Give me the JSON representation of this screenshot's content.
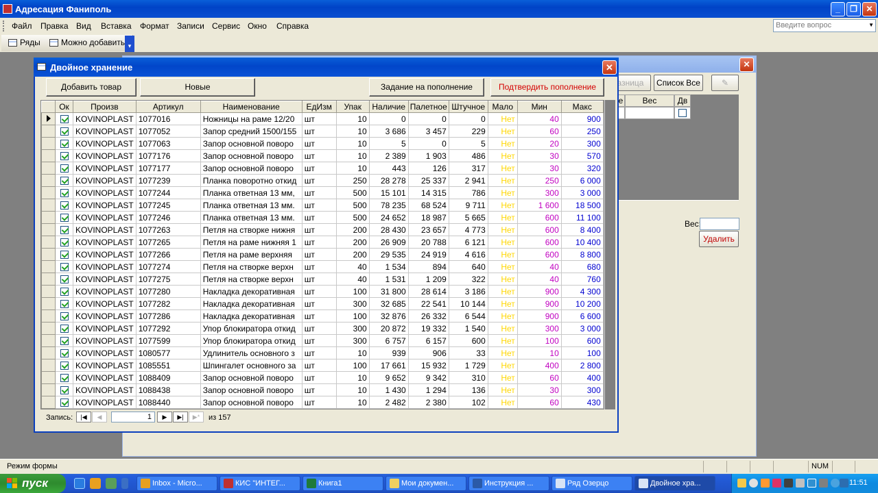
{
  "app": {
    "title": "Адресация Фаниполь",
    "menu": [
      "Файл",
      "Правка",
      "Вид",
      "Вставка",
      "Формат",
      "Записи",
      "Сервис",
      "Окно",
      "Справка"
    ],
    "ask_placeholder": "Введите вопрос",
    "toolbar": {
      "rows_label": "Ряды",
      "can_add_label": "Можно добавить"
    }
  },
  "bg_form": {
    "buttons": {
      "raznica": "азница",
      "list_all": "Список Все",
      "delete": "Удалить"
    },
    "grid_headers": [
      "е",
      "Вес",
      "Дв"
    ],
    "weight_label": "Вес:"
  },
  "form": {
    "title": "Двойное хранение",
    "buttons": {
      "add_product": "Добавить товар",
      "new": "Новые",
      "replenish_task": "Задание на пополнение",
      "confirm_replenish": "Подтвердить пополнение"
    },
    "columns": [
      "Ок",
      "Произв",
      "Артикул",
      "Наименование",
      "ЕдИзм",
      "Упак",
      "Наличие",
      "Палетное",
      "Штучное",
      "Мало",
      "Мин",
      "Макс"
    ],
    "rows": [
      {
        "ok": true,
        "proizv": "KOVINOPLAST",
        "art": "1077016",
        "name": "Ножницы на раме 12/20",
        "ed": "шт",
        "upak": "10",
        "nal": "0",
        "pal": "0",
        "sht": "0",
        "malo": "Нет",
        "min": "40",
        "max": "900"
      },
      {
        "ok": true,
        "proizv": "KOVINOPLAST",
        "art": "1077052",
        "name": "Запор средний 1500/155",
        "ed": "шт",
        "upak": "10",
        "nal": "3 686",
        "pal": "3 457",
        "sht": "229",
        "malo": "Нет",
        "min": "60",
        "max": "250"
      },
      {
        "ok": true,
        "proizv": "KOVINOPLAST",
        "art": "1077063",
        "name": "Запор основной поворо",
        "ed": "шт",
        "upak": "10",
        "nal": "5",
        "pal": "0",
        "sht": "5",
        "malo": "Нет",
        "min": "20",
        "max": "300"
      },
      {
        "ok": true,
        "proizv": "KOVINOPLAST",
        "art": "1077176",
        "name": "Запор основной поворо",
        "ed": "шт",
        "upak": "10",
        "nal": "2 389",
        "pal": "1 903",
        "sht": "486",
        "malo": "Нет",
        "min": "30",
        "max": "570"
      },
      {
        "ok": true,
        "proizv": "KOVINOPLAST",
        "art": "1077177",
        "name": "Запор основной поворо",
        "ed": "шт",
        "upak": "10",
        "nal": "443",
        "pal": "126",
        "sht": "317",
        "malo": "Нет",
        "min": "30",
        "max": "320"
      },
      {
        "ok": true,
        "proizv": "KOVINOPLAST",
        "art": "1077239",
        "name": "Планка поворотно откид",
        "ed": "шт",
        "upak": "250",
        "nal": "28 278",
        "pal": "25 337",
        "sht": "2 941",
        "malo": "Нет",
        "min": "250",
        "max": "6 000"
      },
      {
        "ok": true,
        "proizv": "KOVINOPLAST",
        "art": "1077244",
        "name": "Планка ответная 13 мм,",
        "ed": "шт",
        "upak": "500",
        "nal": "15 101",
        "pal": "14 315",
        "sht": "786",
        "malo": "Нет",
        "min": "300",
        "max": "3 000"
      },
      {
        "ok": true,
        "proizv": "KOVINOPLAST",
        "art": "1077245",
        "name": "Планка ответная 13 мм.",
        "ed": "шт",
        "upak": "500",
        "nal": "78 235",
        "pal": "68 524",
        "sht": "9 711",
        "malo": "Нет",
        "min": "1 600",
        "max": "18 500"
      },
      {
        "ok": true,
        "proizv": "KOVINOPLAST",
        "art": "1077246",
        "name": "Планка ответная 13 мм.",
        "ed": "шт",
        "upak": "500",
        "nal": "24 652",
        "pal": "18 987",
        "sht": "5 665",
        "malo": "Нет",
        "min": "600",
        "max": "11 100"
      },
      {
        "ok": true,
        "proizv": "KOVINOPLAST",
        "art": "1077263",
        "name": "Петля на створке нижня",
        "ed": "шт",
        "upak": "200",
        "nal": "28 430",
        "pal": "23 657",
        "sht": "4 773",
        "malo": "Нет",
        "min": "600",
        "max": "8 400"
      },
      {
        "ok": true,
        "proizv": "KOVINOPLAST",
        "art": "1077265",
        "name": "Петля на раме нижняя 1",
        "ed": "шт",
        "upak": "200",
        "nal": "26 909",
        "pal": "20 788",
        "sht": "6 121",
        "malo": "Нет",
        "min": "600",
        "max": "10 400"
      },
      {
        "ok": true,
        "proizv": "KOVINOPLAST",
        "art": "1077266",
        "name": "Петля на раме верхняя",
        "ed": "шт",
        "upak": "200",
        "nal": "29 535",
        "pal": "24 919",
        "sht": "4 616",
        "malo": "Нет",
        "min": "600",
        "max": "8 800"
      },
      {
        "ok": true,
        "proizv": "KOVINOPLAST",
        "art": "1077274",
        "name": "Петля на створке верхн",
        "ed": "шт",
        "upak": "40",
        "nal": "1 534",
        "pal": "894",
        "sht": "640",
        "malo": "Нет",
        "min": "40",
        "max": "680"
      },
      {
        "ok": true,
        "proizv": "KOVINOPLAST",
        "art": "1077275",
        "name": "Петля на створке верхн",
        "ed": "шт",
        "upak": "40",
        "nal": "1 531",
        "pal": "1 209",
        "sht": "322",
        "malo": "Нет",
        "min": "40",
        "max": "760"
      },
      {
        "ok": true,
        "proizv": "KOVINOPLAST",
        "art": "1077280",
        "name": "Накладка декоративная",
        "ed": "шт",
        "upak": "100",
        "nal": "31 800",
        "pal": "28 614",
        "sht": "3 186",
        "malo": "Нет",
        "min": "900",
        "max": "4 300"
      },
      {
        "ok": true,
        "proizv": "KOVINOPLAST",
        "art": "1077282",
        "name": "Накладка декоративная",
        "ed": "шт",
        "upak": "300",
        "nal": "32 685",
        "pal": "22 541",
        "sht": "10 144",
        "malo": "Нет",
        "min": "900",
        "max": "10 200"
      },
      {
        "ok": true,
        "proizv": "KOVINOPLAST",
        "art": "1077286",
        "name": "Накладка декоративная",
        "ed": "шт",
        "upak": "100",
        "nal": "32 876",
        "pal": "26 332",
        "sht": "6 544",
        "malo": "Нет",
        "min": "900",
        "max": "6 600"
      },
      {
        "ok": true,
        "proizv": "KOVINOPLAST",
        "art": "1077292",
        "name": "Упор блокиратора откид",
        "ed": "шт",
        "upak": "300",
        "nal": "20 872",
        "pal": "19 332",
        "sht": "1 540",
        "malo": "Нет",
        "min": "300",
        "max": "3 000"
      },
      {
        "ok": true,
        "proizv": "KOVINOPLAST",
        "art": "1077599",
        "name": "Упор блокиратора откид",
        "ed": "шт",
        "upak": "300",
        "nal": "6 757",
        "pal": "6 157",
        "sht": "600",
        "malo": "Нет",
        "min": "100",
        "max": "600"
      },
      {
        "ok": true,
        "proizv": "KOVINOPLAST",
        "art": "1080577",
        "name": "Удлинитель основного з",
        "ed": "шт",
        "upak": "10",
        "nal": "939",
        "pal": "906",
        "sht": "33",
        "malo": "Нет",
        "min": "10",
        "max": "100"
      },
      {
        "ok": true,
        "proizv": "KOVINOPLAST",
        "art": "1085551",
        "name": "Шпингалет основного за",
        "ed": "шт",
        "upak": "100",
        "nal": "17 661",
        "pal": "15 932",
        "sht": "1 729",
        "malo": "Нет",
        "min": "400",
        "max": "2 800"
      },
      {
        "ok": true,
        "proizv": "KOVINOPLAST",
        "art": "1088409",
        "name": "Запор основной поворо",
        "ed": "шт",
        "upak": "10",
        "nal": "9 652",
        "pal": "9 342",
        "sht": "310",
        "malo": "Нет",
        "min": "60",
        "max": "400"
      },
      {
        "ok": true,
        "proizv": "KOVINOPLAST",
        "art": "1088438",
        "name": "Запор основной поворо",
        "ed": "шт",
        "upak": "10",
        "nal": "1 430",
        "pal": "1 294",
        "sht": "136",
        "malo": "Нет",
        "min": "30",
        "max": "300"
      },
      {
        "ok": true,
        "proizv": "KOVINOPLAST",
        "art": "1088440",
        "name": "Запор основной поворо",
        "ed": "шт",
        "upak": "10",
        "nal": "2 482",
        "pal": "2 380",
        "sht": "102",
        "malo": "Нет",
        "min": "60",
        "max": "430"
      }
    ],
    "nav": {
      "label": "Запись:",
      "current": "1",
      "of_text": "из  157"
    }
  },
  "status": {
    "mode": "Режим формы",
    "num": "NUM"
  },
  "taskbar": {
    "start": "пуск",
    "items": [
      "Inbox - Micro...",
      "КИС \"ИНТЕГ...",
      "Книга1",
      "Мои докумен...",
      "Инструкция ...",
      "Ряд Озерцо",
      "Двойное хра..."
    ],
    "clock": "11:51"
  }
}
